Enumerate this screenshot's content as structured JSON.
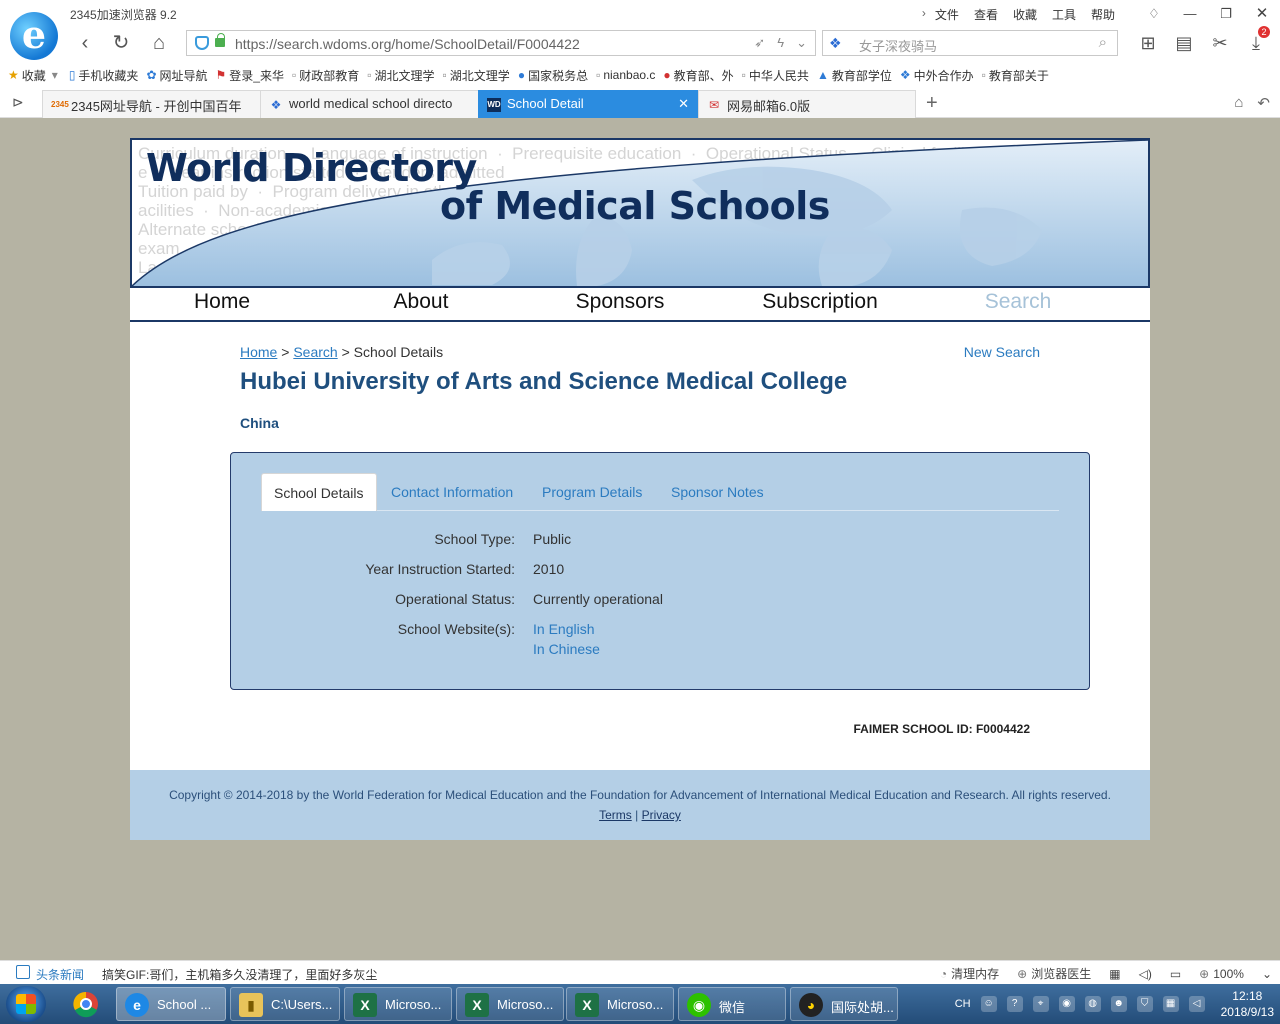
{
  "browser": {
    "app_title": "2345加速浏览器 9.2",
    "menu": [
      "文件",
      "查看",
      "收藏",
      "工具",
      "帮助"
    ],
    "url": "https://search.wdoms.org/home/SchoolDetail/F0004422",
    "search_placeholder": "女子深夜骑马",
    "download_badge": "2",
    "bookmarks": [
      "收藏",
      "手机收藏夹",
      "网址导航",
      "登录_来华",
      "财政部教育",
      "湖北文理学",
      "湖北文理学",
      "国家税务总",
      "nianbao.c",
      "教育部、外",
      "中华人民共",
      "教育部学位",
      "中外合作办",
      "教育部关于"
    ],
    "tabs": [
      {
        "label": "2345网址导航 - 开创中国百年",
        "favicon": "2345"
      },
      {
        "label": "world medical school directo",
        "favicon": "paw"
      },
      {
        "label": "School Detail",
        "favicon": "WD"
      },
      {
        "label": "网易邮箱6.0版",
        "favicon": "mail"
      }
    ]
  },
  "site": {
    "banner": {
      "title_line1": "World Directory",
      "title_line2": "of Medical Schools",
      "bg_lines": [
        "Curriculum duration  ·  Language of instruction  ·  Prerequisite education  ·  Operational Status  ·  Clinical facilities",
        "e  ·  Year instruction started  ·  Genders admitted",
        "Tuition paid by  ·  Program delivery in other countries",
        "acilities  ·  Non-academic affiliations",
        "Alternate school name",
        "exam",
        "La"
      ]
    },
    "nav": [
      "Home",
      "About",
      "Sponsors",
      "Subscription",
      "Search"
    ],
    "breadcrumb": {
      "home": "Home",
      "search": "Search",
      "current": "School Details",
      "sep": ">"
    },
    "new_search": "New Search",
    "school_name": "Hubei University of Arts and Science Medical College",
    "country": "China",
    "panel_tabs": [
      "School Details",
      "Contact Information",
      "Program Details",
      "Sponsor Notes"
    ],
    "details": {
      "school_type": {
        "label": "School Type:",
        "value": "Public"
      },
      "year_started": {
        "label": "Year Instruction Started:",
        "value": "2010"
      },
      "status": {
        "label": "Operational Status:",
        "value": "Currently operational"
      },
      "website": {
        "label": "School Website(s):",
        "links": [
          "In English",
          "In Chinese"
        ]
      }
    },
    "faimer_id": "FAIMER SCHOOL ID: F0004422",
    "footer": {
      "copyright": "Copyright © 2014-2018 by the World Federation for Medical Education and the Foundation for Advancement of International Medical Education and Research. All rights reserved.",
      "terms": "Terms",
      "sep": "|",
      "privacy": "Privacy"
    }
  },
  "statusbar": {
    "news_label": "头条新闻",
    "news_text": "搞笑GIF:哥们，主机箱多久没清理了，里面好多灰尘",
    "clean_memory": "清理内存",
    "doctor": "浏览器医生",
    "zoom": "100%"
  },
  "taskbar": {
    "buttons": [
      "School ...",
      "C:\\Users...",
      "Microso...",
      "Microso...",
      "Microso...",
      "微信",
      "国际处胡..."
    ],
    "tray_lang": "CH",
    "time": "12:18",
    "date": "2018/9/13"
  },
  "colors": {
    "navy": "#1b3866",
    "link": "#2b7bc0",
    "panel": "#b4cfe6",
    "active_tab": "#2b8ce0"
  }
}
